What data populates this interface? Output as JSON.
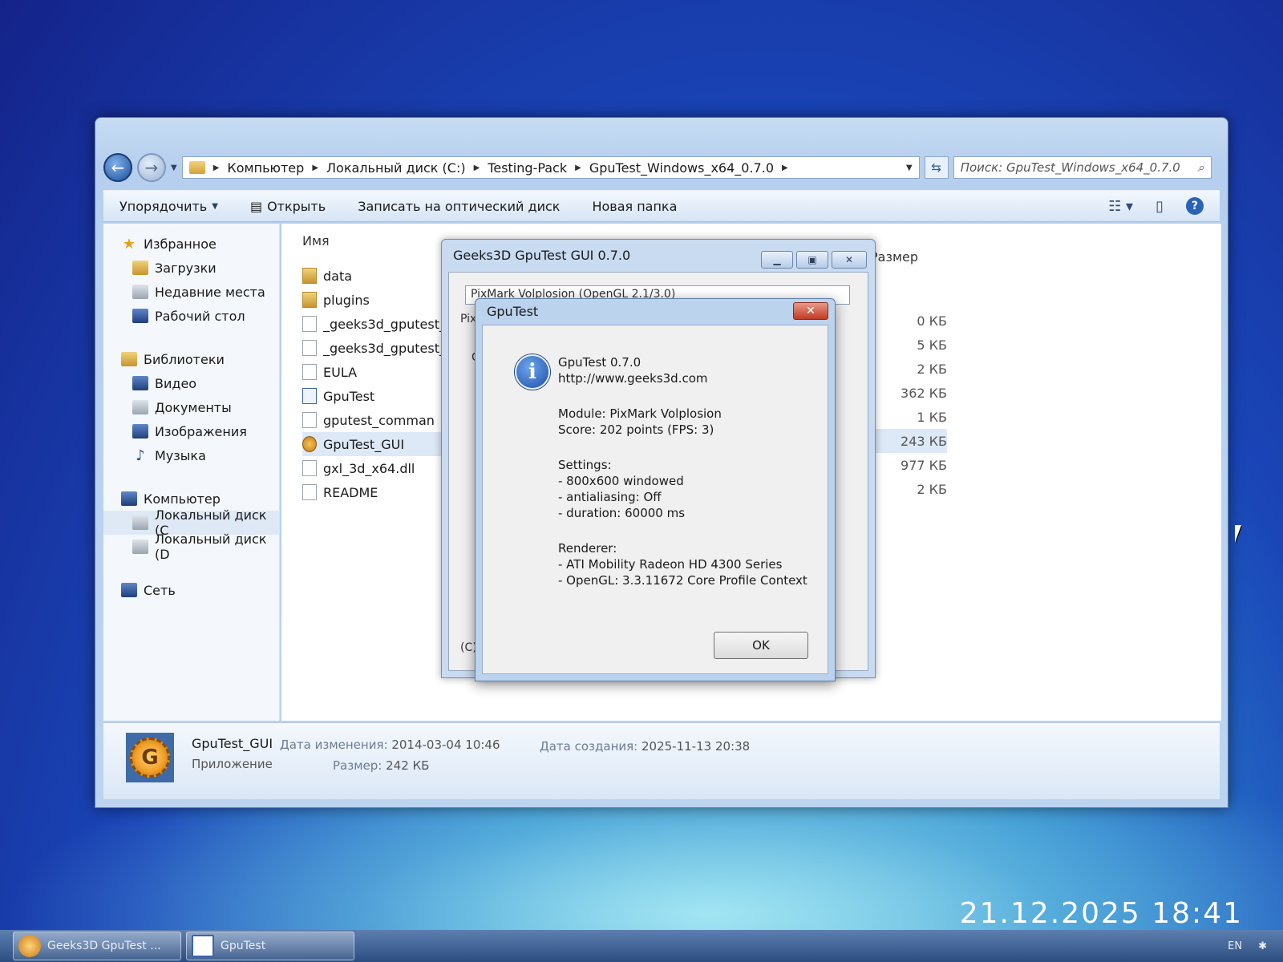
{
  "explorer": {
    "address": [
      "Компьютер",
      "Локальный диск (C:)",
      "Testing-Pack",
      "GpuTest_Windows_x64_0.7.0"
    ],
    "search_placeholder": "Поиск: GpuTest_Windows_x64_0.7.0",
    "toolbar": {
      "organize": "Упорядочить",
      "open": "Открыть",
      "burn": "Записать на оптический диск",
      "new_folder": "Новая папка"
    },
    "sidebar": {
      "favorites": "Избранное",
      "favorites_items": [
        "Загрузки",
        "Недавние места",
        "Рабочий стол"
      ],
      "libraries": "Библиотеки",
      "libraries_items": [
        "Видео",
        "Документы",
        "Изображения",
        "Музыка"
      ],
      "computer": "Компьютер",
      "computer_items": [
        "Локальный диск (C",
        "Локальный диск (D"
      ],
      "network": "Сеть"
    },
    "columns": {
      "name": "Имя",
      "size": "Размер"
    },
    "files": [
      "data",
      "plugins",
      "_geeks3d_gputest_",
      "_geeks3d_gputest_",
      "EULA",
      "GpuTest",
      "gputest_comman",
      "GpuTest_GUI",
      "gxl_3d_x64.dll",
      "README"
    ],
    "sizes": [
      "0 КБ",
      "5 КБ",
      "2 КБ",
      "362 КБ",
      "1 КБ",
      "243 КБ",
      "977 КБ",
      "2 КБ"
    ],
    "details": {
      "name": "GpuTest_GUI",
      "type": "Приложение",
      "modified_label": "Дата изменения:",
      "modified_value": "2014-03-04 10:46",
      "size_label": "Размер:",
      "size_value": "242 КБ",
      "created_label": "Дата создания:",
      "created_value": "2025-11-13 20:38"
    }
  },
  "gui_window": {
    "title": "Geeks3D GpuTest GUI 0.7.0",
    "select_value": "PixMark Volplosion (OpenGL 2.1/3.0)",
    "frag_pix": "Pix",
    "frag_c": "C",
    "frag_copyright": "(C)"
  },
  "dialog": {
    "title": "GpuTest",
    "lines": [
      "GpuTest 0.7.0",
      "http://www.geeks3d.com",
      "Module: PixMark Volplosion",
      "Score: 202 points (FPS: 3)",
      "Settings:",
      "- 800x600 windowed",
      "- antialiasing: Off",
      "- duration: 60000 ms",
      "Renderer:",
      "- ATI Mobility Radeon HD 4300 Series",
      "- OpenGL: 3.3.11672 Core Profile Context"
    ],
    "ok_label": "OK"
  },
  "photo_timestamp": "21.12.2025 18:41",
  "taskbar": {
    "items": [
      "Geeks3D GpuTest ...",
      "GpuTest"
    ],
    "lang": "EN"
  }
}
